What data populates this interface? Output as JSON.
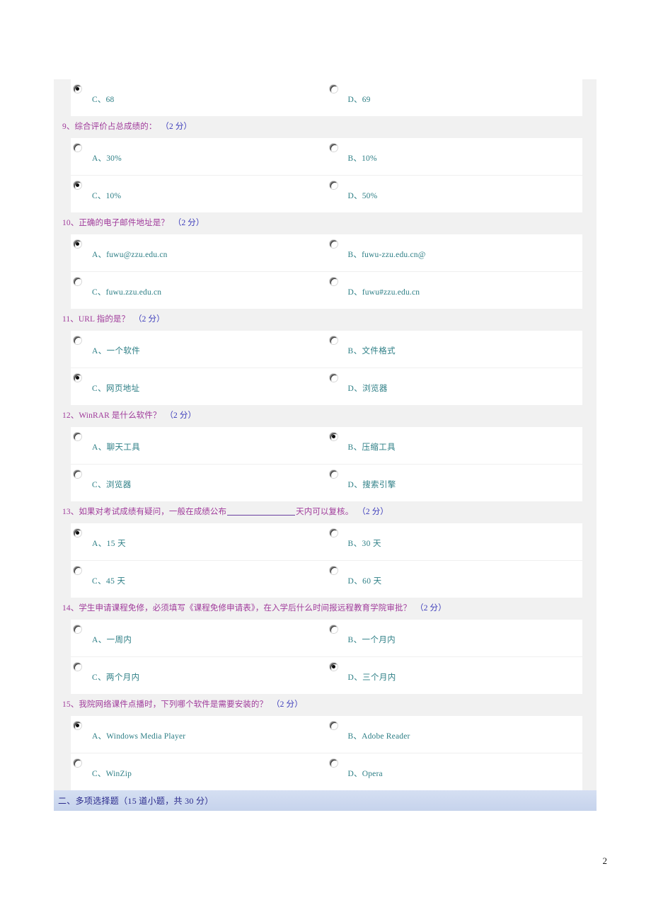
{
  "page": {
    "number": "2"
  },
  "continued_question": {
    "options": [
      {
        "label": "C、68",
        "checked": true,
        "cjk": false
      },
      {
        "label": "D、69",
        "checked": false,
        "cjk": false
      }
    ]
  },
  "questions": [
    {
      "number": "9、",
      "text": "综合评价占总成绩的：",
      "has_blank": false,
      "blank_suffix": "",
      "score": "（2 分）",
      "options": [
        {
          "label": "A、30%",
          "checked": false,
          "cjk": false
        },
        {
          "label": "B、10%",
          "checked": false,
          "cjk": false
        },
        {
          "label": "C、10%",
          "checked": true,
          "cjk": false
        },
        {
          "label": "D、50%",
          "checked": false,
          "cjk": false
        }
      ]
    },
    {
      "number": "10、",
      "text": "正确的电子邮件地址是？",
      "has_blank": false,
      "blank_suffix": "",
      "score": "（2 分）",
      "options": [
        {
          "label": "A、fuwu@zzu.edu.cn",
          "checked": true,
          "cjk": false
        },
        {
          "label": "B、fuwu-zzu.edu.cn@",
          "checked": false,
          "cjk": false
        },
        {
          "label": "C、fuwu.zzu.edu.cn",
          "checked": false,
          "cjk": false
        },
        {
          "label": "D、fuwu#zzu.edu.cn",
          "checked": false,
          "cjk": false
        }
      ]
    },
    {
      "number": "11、",
      "text": "URL 指的是？",
      "has_blank": false,
      "blank_suffix": "",
      "score": "（2 分）",
      "options": [
        {
          "label": "A、一个软件",
          "checked": false,
          "cjk": true
        },
        {
          "label": "B、文件格式",
          "checked": false,
          "cjk": true
        },
        {
          "label": "C、网页地址",
          "checked": true,
          "cjk": true
        },
        {
          "label": "D、浏览器",
          "checked": false,
          "cjk": true
        }
      ]
    },
    {
      "number": "12、",
      "text": "WinRAR 是什么软件？",
      "has_blank": false,
      "blank_suffix": "",
      "score": "（2 分）",
      "options": [
        {
          "label": "A、聊天工具",
          "checked": false,
          "cjk": true
        },
        {
          "label": "B、压缩工具",
          "checked": true,
          "cjk": true
        },
        {
          "label": "C、浏览器",
          "checked": false,
          "cjk": true
        },
        {
          "label": "D、搜索引擎",
          "checked": false,
          "cjk": true
        }
      ]
    },
    {
      "number": "13、",
      "text": "如果对考试成绩有疑问，一般在成绩公布",
      "has_blank": true,
      "blank_suffix": "天内可以复核。",
      "score": "（2 分）",
      "options": [
        {
          "label": "A、15 天",
          "checked": true,
          "cjk": true
        },
        {
          "label": "B、30 天",
          "checked": false,
          "cjk": true
        },
        {
          "label": "C、45 天",
          "checked": false,
          "cjk": true
        },
        {
          "label": "D、60 天",
          "checked": false,
          "cjk": true
        }
      ]
    },
    {
      "number": "14、",
      "text": "学生申请课程免修，必须填写《课程免修申请表》，在入学后什么时间报远程教育学院审批？",
      "has_blank": false,
      "blank_suffix": "",
      "score": "（2 分）",
      "options": [
        {
          "label": "A、一周内",
          "checked": false,
          "cjk": true
        },
        {
          "label": "B、一个月内",
          "checked": false,
          "cjk": true
        },
        {
          "label": "C、两个月内",
          "checked": false,
          "cjk": true
        },
        {
          "label": "D、三个月内",
          "checked": true,
          "cjk": true
        }
      ]
    },
    {
      "number": "15、",
      "text": "我院网络课件点播时，下列哪个软件是需要安装的？",
      "has_blank": false,
      "blank_suffix": "",
      "score": "（2 分）",
      "options": [
        {
          "label": "A、Windows  Media  Player",
          "checked": true,
          "cjk": false
        },
        {
          "label": "B、Adobe  Reader",
          "checked": false,
          "cjk": false
        },
        {
          "label": "C、WinZip",
          "checked": false,
          "cjk": false
        },
        {
          "label": "D、Opera",
          "checked": false,
          "cjk": false
        }
      ]
    }
  ],
  "section_heading": {
    "label": "二、多项选择题（15 道小题，共 30 分）"
  }
}
